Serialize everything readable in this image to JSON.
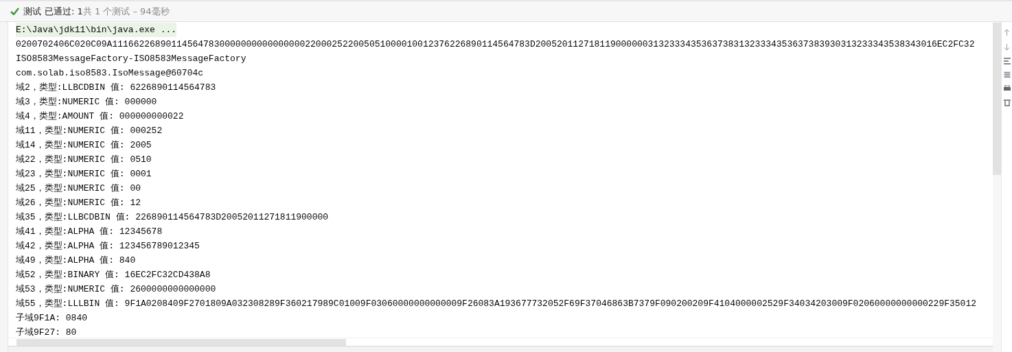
{
  "header": {
    "passed": true,
    "title": "测试",
    "status": "已通过:",
    "count": "1",
    "summary": "共 1 个测试 – 94毫秒"
  },
  "console": [
    {
      "kind": "command",
      "text": "E:\\Java\\jdk11\\bin\\java.exe ..."
    },
    {
      "kind": "output",
      "text": "0200702406C020C09A111662268901145647830000000000000000220002522005051000010012376226890114564783D200520112718119000000313233343536373831323334353637383930313233343538343016EC2FC32"
    },
    {
      "kind": "output",
      "text": "ISO8583MessageFactory-ISO8583MessageFactory"
    },
    {
      "kind": "output",
      "text": "com.solab.iso8583.IsoMessage@60704c"
    },
    {
      "kind": "output",
      "text": "域2，类型:LLBCDBIN 值: 6226890114564783"
    },
    {
      "kind": "output",
      "text": "域3，类型:NUMERIC 值: 000000"
    },
    {
      "kind": "output",
      "text": "域4，类型:AMOUNT 值: 000000000022"
    },
    {
      "kind": "output",
      "text": "域11，类型:NUMERIC 值: 000252"
    },
    {
      "kind": "output",
      "text": "域14，类型:NUMERIC 值: 2005"
    },
    {
      "kind": "output",
      "text": "域22，类型:NUMERIC 值: 0510"
    },
    {
      "kind": "output",
      "text": "域23，类型:NUMERIC 值: 0001"
    },
    {
      "kind": "output",
      "text": "域25，类型:NUMERIC 值: 00"
    },
    {
      "kind": "output",
      "text": "域26，类型:NUMERIC 值: 12"
    },
    {
      "kind": "output",
      "text": "域35，类型:LLBCDBIN 值: 226890114564783D20052011271811900000"
    },
    {
      "kind": "output",
      "text": "域41，类型:ALPHA 值: 12345678"
    },
    {
      "kind": "output",
      "text": "域42，类型:ALPHA 值: 123456789012345"
    },
    {
      "kind": "output",
      "text": "域49，类型:ALPHA 值: 840"
    },
    {
      "kind": "output",
      "text": "域52，类型:BINARY 值: 16EC2FC32CD438A8"
    },
    {
      "kind": "output",
      "text": "域53，类型:NUMERIC 值: 2600000000000000"
    },
    {
      "kind": "output",
      "text": "域55，类型:LLLBIN 值: 9F1A0208409F2701809A032308289F360217989C01009F03060000000000009F26083A193677732052F69F37046863B7379F090200209F4104000002529F34034203009F02060000000000229F35012"
    },
    {
      "kind": "output",
      "text": "子域9F1A: 0840"
    },
    {
      "kind": "output",
      "text": "子域9F27: 80"
    }
  ]
}
